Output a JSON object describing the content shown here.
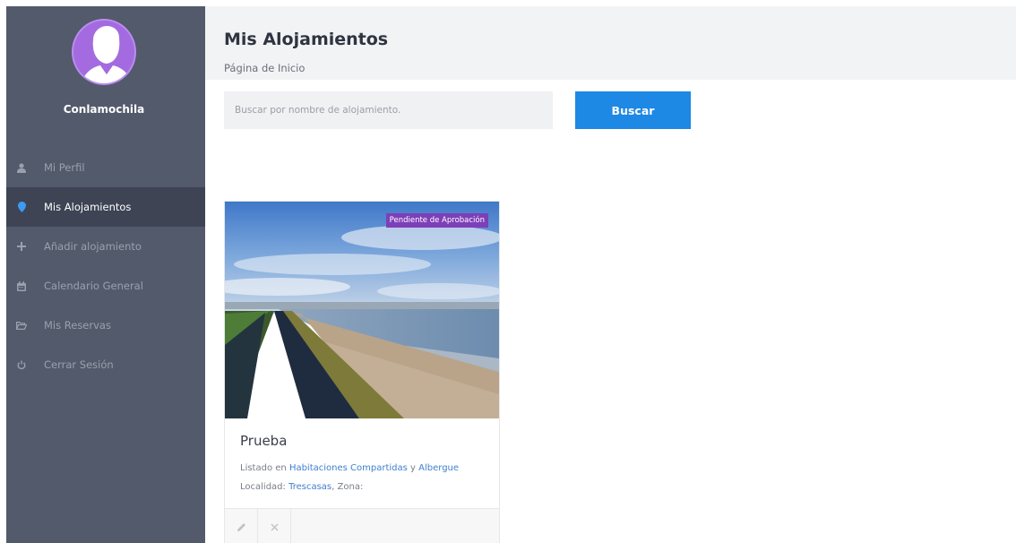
{
  "profile": {
    "username": "Conlamochila"
  },
  "sidebar": {
    "items": [
      {
        "label": "Mi Perfil",
        "icon": "user-icon",
        "active": false
      },
      {
        "label": "Mis Alojamientos",
        "icon": "map-marker-icon",
        "active": true
      },
      {
        "label": "Añadir alojamiento",
        "icon": "plus-icon",
        "active": false
      },
      {
        "label": "Calendario General",
        "icon": "calendar-icon",
        "active": false
      },
      {
        "label": "Mis Reservas",
        "icon": "folder-open-icon",
        "active": false
      },
      {
        "label": "Cerrar Sesión",
        "icon": "power-icon",
        "active": false
      }
    ]
  },
  "header": {
    "title": "Mis Alojamientos",
    "breadcrumb": "Página de Inicio"
  },
  "search": {
    "placeholder": "Buscar por nombre de alojamiento.",
    "button_label": "Buscar"
  },
  "listing": {
    "badge": "Pendiente de Aprobación",
    "title": "Prueba",
    "listed_prefix": "Listado en",
    "category_1": "Habitaciones Compartidas",
    "connector": "y",
    "category_2": "Albergue",
    "locality_label": "Localidad:",
    "locality": "Trescasas",
    "zone_label": ", Zona:"
  },
  "colors": {
    "sidebar_bg": "#535a6b",
    "active_item_bg": "#3e4454",
    "accent_blue": "#1e88e5",
    "badge_purple": "#7d3fb8",
    "avatar_purple": "#a46be0"
  }
}
